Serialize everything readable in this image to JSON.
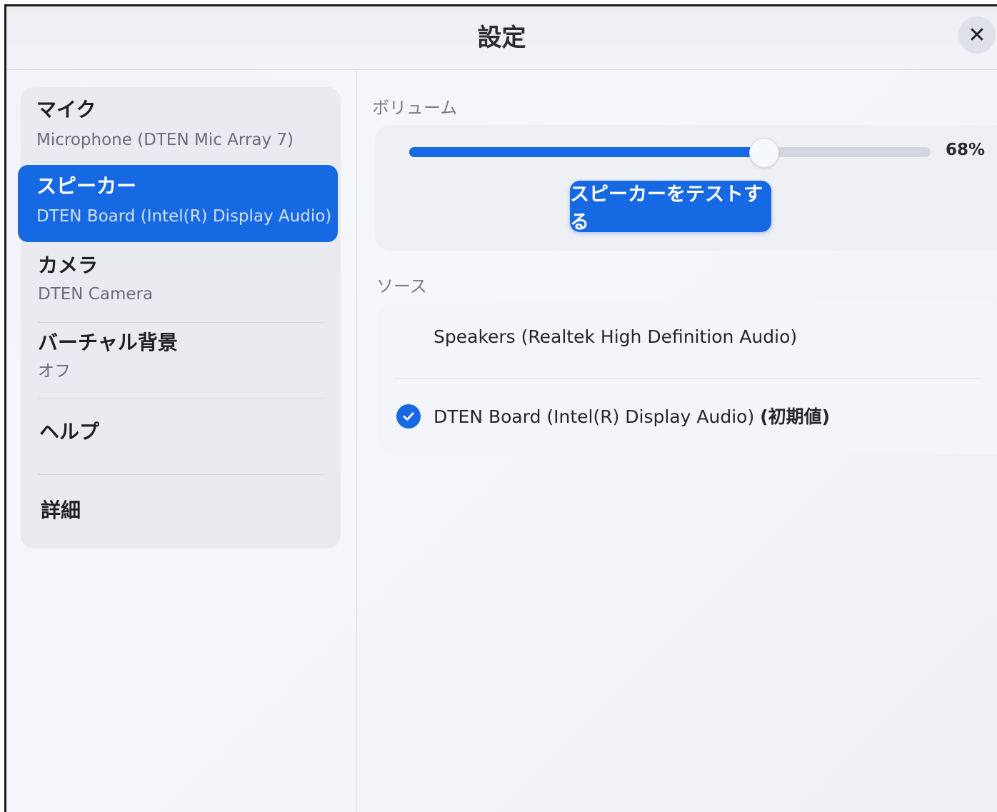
{
  "window": {
    "title": "設定",
    "close_icon": "close-icon"
  },
  "sidebar": {
    "items": [
      {
        "label": "マイク",
        "sub": "Microphone (DTEN Mic Array 7)",
        "active": false
      },
      {
        "label": "スピーカー",
        "sub": "DTEN Board (Intel(R) Display Audio)",
        "active": true
      },
      {
        "label": "カメラ",
        "sub": "DTEN Camera",
        "active": false
      },
      {
        "label": "バーチャル背景",
        "sub": "オフ",
        "active": false
      },
      {
        "label": "ヘルプ",
        "sub": "",
        "active": false
      },
      {
        "label": "詳細",
        "sub": "",
        "active": false
      }
    ]
  },
  "volume": {
    "section_label": "ボリューム",
    "value": 68,
    "value_text": "68%",
    "test_button_label": "スピーカーをテストする"
  },
  "source": {
    "section_label": "ソース",
    "options": [
      {
        "name": "Speakers (Realtek High Definition Audio)",
        "suffix": "",
        "selected": false
      },
      {
        "name": "DTEN Board (Intel(R) Display Audio) ",
        "suffix": "(初期値)",
        "selected": true
      }
    ]
  },
  "colors": {
    "accent": "#1668e3",
    "background": "#f3f4f8"
  }
}
